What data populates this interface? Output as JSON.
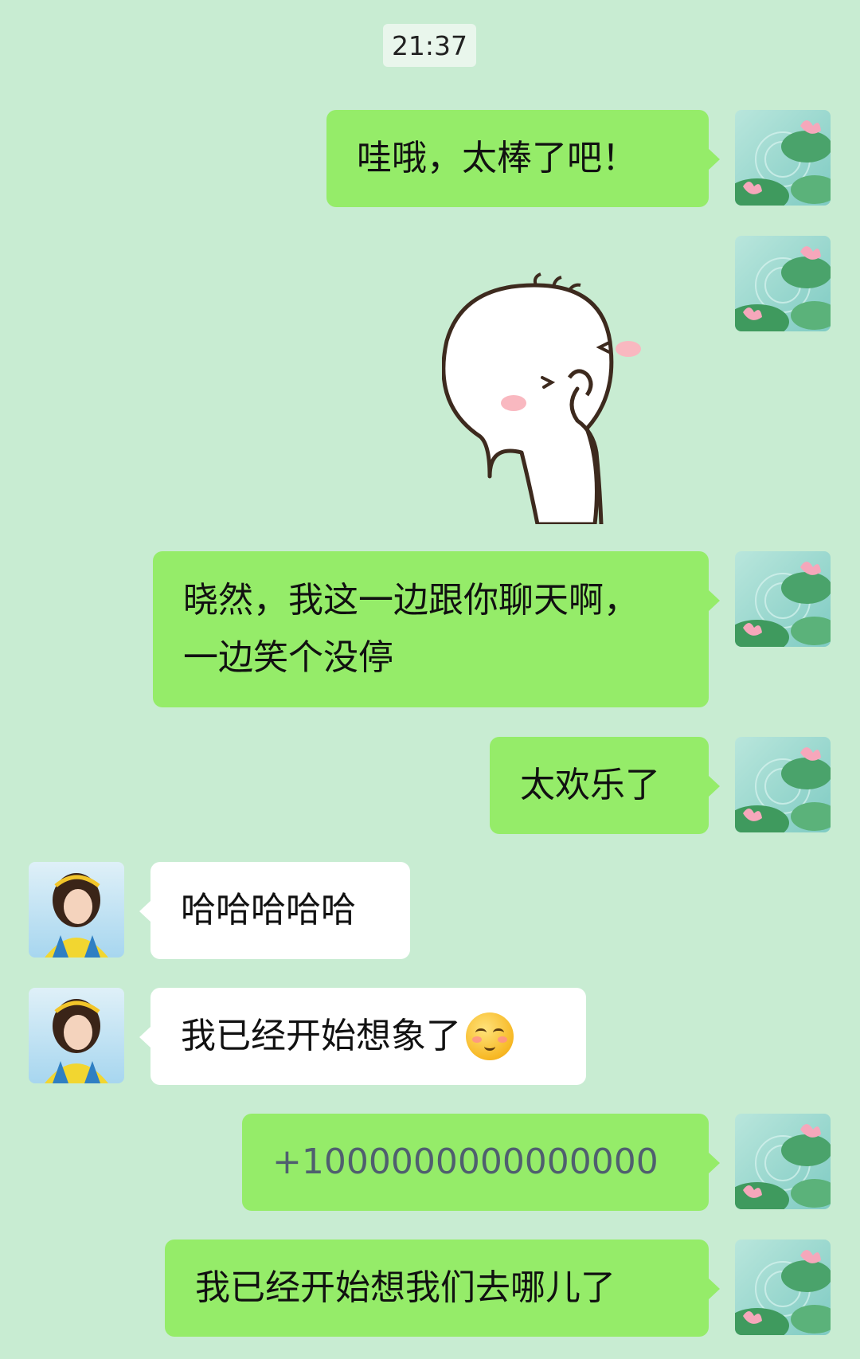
{
  "timestamp": "21:37",
  "messages": [
    {
      "sender": "me",
      "text": "哇哦，太棒了吧！"
    },
    {
      "sender": "me",
      "type": "sticker",
      "sticker": "shy-laughing-bun-sticker"
    },
    {
      "sender": "me",
      "lines": [
        "晓然，我这一边跟你聊天啊，",
        "一边笑个没停"
      ]
    },
    {
      "sender": "me",
      "text": "太欢乐了"
    },
    {
      "sender": "friend",
      "text": "哈哈哈哈哈"
    },
    {
      "sender": "friend",
      "text": "我已经开始想象了",
      "emoji": "shy-smile-emoji"
    },
    {
      "sender": "me",
      "text": "+1000000000000000"
    },
    {
      "sender": "me",
      "text": "我已经开始想我们去哪儿了"
    }
  ],
  "colors": {
    "background": "#c8ecd2",
    "sent_bubble": "#95ec69",
    "received_bubble": "#ffffff"
  },
  "avatars": {
    "me": "lotus-pond-avatar",
    "friend": "girl-yellow-shirt-avatar"
  }
}
